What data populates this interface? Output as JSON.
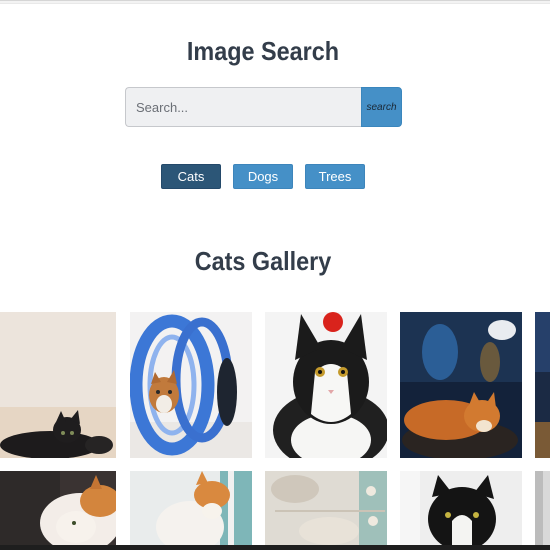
{
  "header": {
    "title": "Image Search"
  },
  "search": {
    "placeholder": "Search...",
    "button_label": "search"
  },
  "categories": [
    {
      "label": "Cats",
      "active": true
    },
    {
      "label": "Dogs",
      "active": false
    },
    {
      "label": "Trees",
      "active": false
    }
  ],
  "gallery": {
    "title": "Cats Gallery",
    "images": [
      {
        "subject": "black cat lying on floor"
      },
      {
        "subject": "tabby cat inside blue tunnel toy"
      },
      {
        "subject": "black and white cat with red pompom"
      },
      {
        "subject": "orange cat on cushion at night"
      },
      {
        "subject": "partial image"
      },
      {
        "subject": "calico cat lying down"
      },
      {
        "subject": "orange and white cat by window"
      },
      {
        "subject": "cat paws on patterned blanket"
      },
      {
        "subject": "black and white cat in dark room"
      },
      {
        "subject": "partial image"
      }
    ]
  },
  "colors": {
    "primary": "#4590c7",
    "active": "#2c5677",
    "heading": "#333d4a"
  }
}
